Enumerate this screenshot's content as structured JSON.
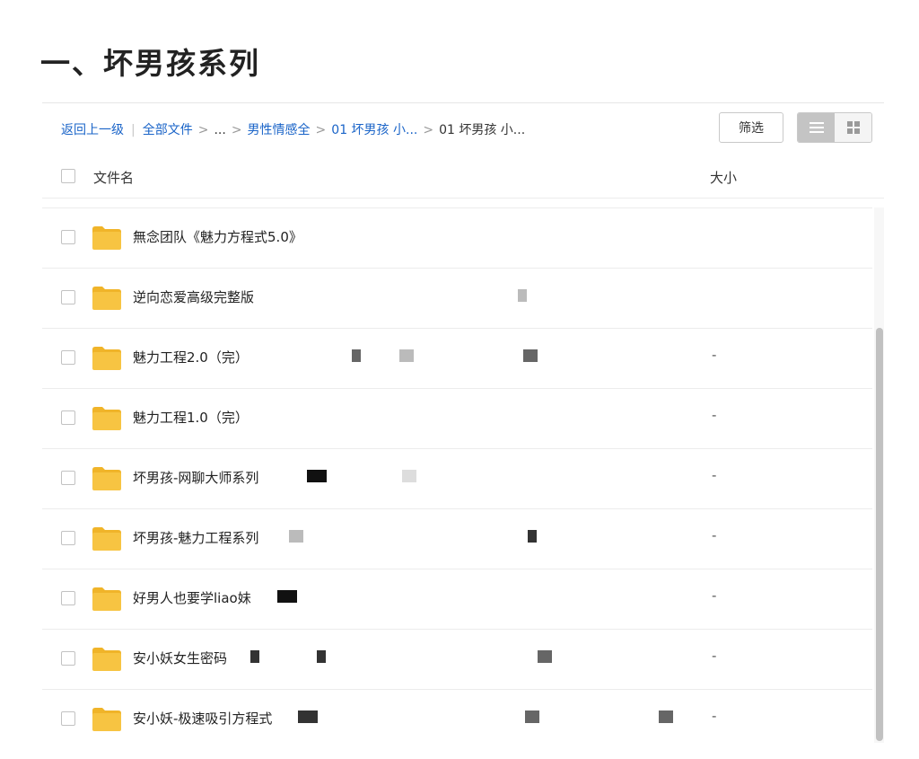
{
  "page": {
    "title": "一、坏男孩系列"
  },
  "toolbar": {
    "breadcrumb": {
      "back": "返回上一级",
      "all_files": "全部文件",
      "ellipsis": "...",
      "level1": "男性情感全",
      "level2": "01 坏男孩 小...",
      "current": "01 坏男孩 小...",
      "separator": ">",
      "divider": "|"
    },
    "filter_label": "筛选",
    "view_modes": [
      "list-view-icon",
      "grid-view-icon"
    ],
    "active_view": "list"
  },
  "table": {
    "columns": {
      "name": "文件名",
      "size": "大小"
    }
  },
  "files": [
    {
      "name": "無念团队《魅力方程式5.0》",
      "size": "",
      "icon": "folder-icon"
    },
    {
      "name": "逆向恋爱高级完整版",
      "size": "",
      "icon": "folder-icon"
    },
    {
      "name": "魅力工程2.0（完）",
      "size": "-",
      "icon": "folder-icon"
    },
    {
      "name": "魅力工程1.0（完）",
      "size": "-",
      "icon": "folder-icon"
    },
    {
      "name": "坏男孩-网聊大师系列",
      "size": "-",
      "icon": "folder-icon"
    },
    {
      "name": "坏男孩-魅力工程系列",
      "size": "-",
      "icon": "folder-icon"
    },
    {
      "name": "好男人也要学liao妹",
      "size": "-",
      "icon": "folder-icon"
    },
    {
      "name": "安小妖女生密码",
      "size": "-",
      "icon": "folder-icon"
    },
    {
      "name": "安小妖-极速吸引方程式",
      "size": "-",
      "icon": "folder-icon"
    }
  ],
  "colors": {
    "link": "#1a64c8",
    "folder": "#f7c442",
    "folder_tab": "#f0b429",
    "view_active": "#c4c4c4"
  }
}
